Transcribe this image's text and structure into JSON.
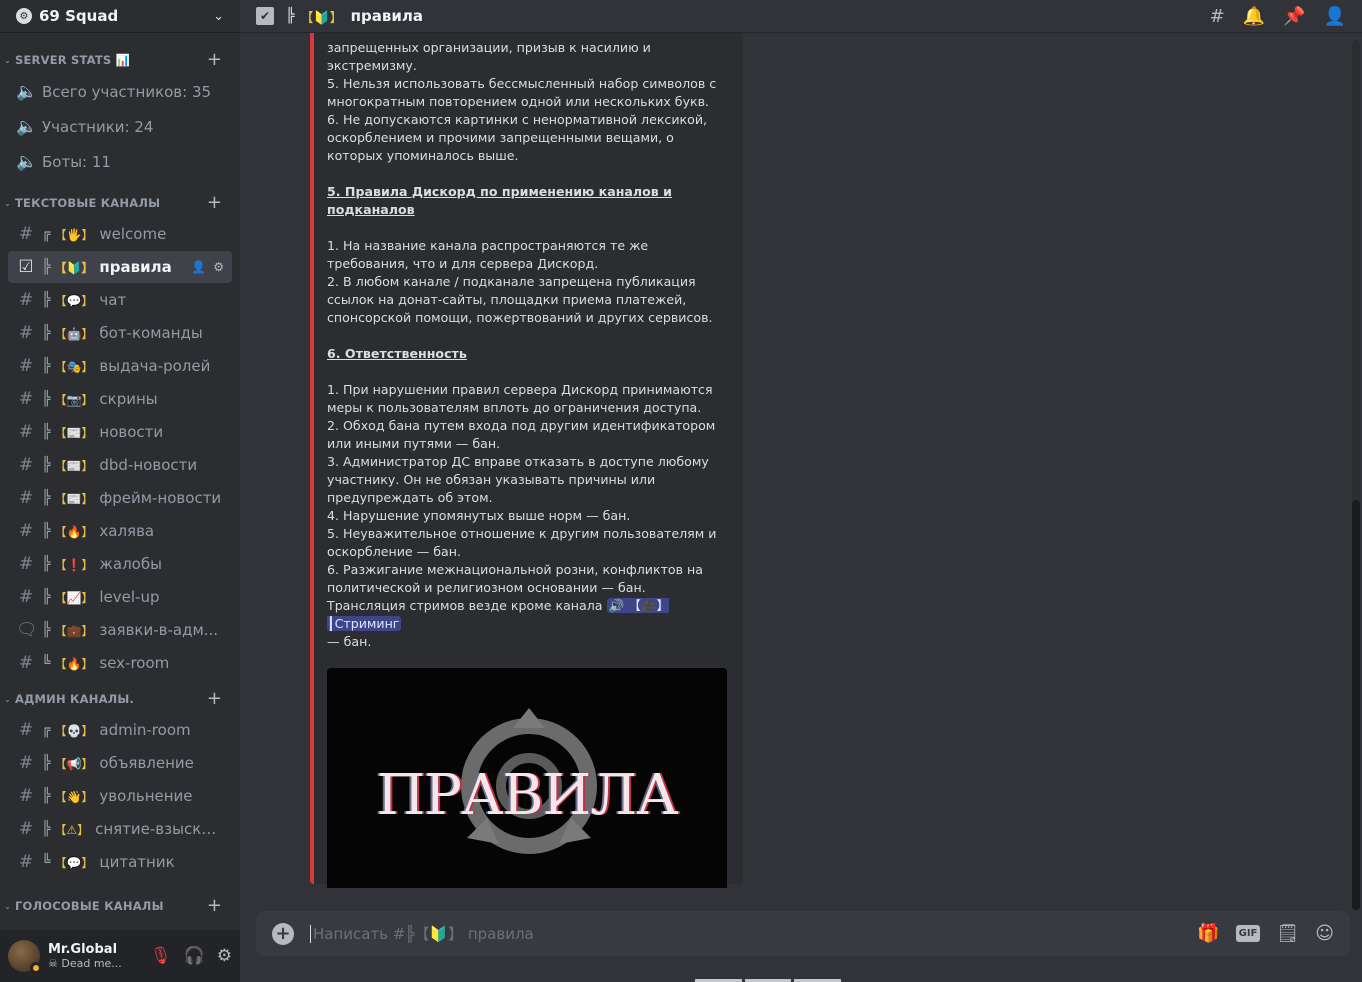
{
  "server": {
    "name": "69 Squad",
    "icon": "gear-icon"
  },
  "categories": {
    "stats": {
      "label": "SERVER STATS 📊",
      "items": [
        {
          "label": "Всего участников: 35"
        },
        {
          "label": "Участники: 24"
        },
        {
          "label": "Боты: 11"
        }
      ]
    },
    "text": {
      "label": "ТЕКСТОВЫЕ КАНАЛЫ",
      "items": [
        {
          "prefix": "╔",
          "emoji": "【🖐】",
          "label": "welcome"
        },
        {
          "prefix": "╠",
          "emoji": "【🔰】",
          "label": "правила"
        },
        {
          "prefix": "╠",
          "emoji": "【💬】",
          "label": "чат"
        },
        {
          "prefix": "╠",
          "emoji": "【🤖】",
          "label": "бот-команды"
        },
        {
          "prefix": "╠",
          "emoji": "【🎭】",
          "label": "выдача-ролей"
        },
        {
          "prefix": "╠",
          "emoji": "【📷】",
          "label": "скрины"
        },
        {
          "prefix": "╠",
          "emoji": "【📰】",
          "label": "новости"
        },
        {
          "prefix": "╠",
          "emoji": "【📰】",
          "label": "dbd-новости"
        },
        {
          "prefix": "╠",
          "emoji": "【📰】",
          "label": "фрейм-новости"
        },
        {
          "prefix": "╠",
          "emoji": "【🔥】",
          "label": "халява"
        },
        {
          "prefix": "╠",
          "emoji": "【❗】",
          "label": "жалобы"
        },
        {
          "prefix": "╠",
          "emoji": "【📈】",
          "label": "level-up"
        },
        {
          "prefix": "╠",
          "emoji": "【💼】",
          "label": "заявки-в-адм..."
        },
        {
          "prefix": "╚",
          "emoji": "【🔥】",
          "label": "sex-room"
        }
      ]
    },
    "admin": {
      "label": "АДМИН КАНАЛЫ.",
      "items": [
        {
          "prefix": "╔",
          "emoji": "【💀】",
          "label": "admin-room"
        },
        {
          "prefix": "╠",
          "emoji": "【📢】",
          "label": "объявление"
        },
        {
          "prefix": "╠",
          "emoji": "【👋】",
          "label": "увольнение"
        },
        {
          "prefix": "╠",
          "emoji": "【⚠】",
          "label": "снятие-взыска..."
        },
        {
          "prefix": "╚",
          "emoji": "【💬】",
          "label": "цитатник"
        }
      ]
    },
    "voice": {
      "label": "ГОЛОСОВЫЕ КАНАЛЫ"
    }
  },
  "topbar": {
    "prefix": "╠",
    "emoji": "【🔰】",
    "title": "правила"
  },
  "embed": {
    "lines_a": [
      "запрещенных организации, призыв к насилию и экстремизму.",
      "5. Нельзя использовать бессмысленный набор символов с многократным повторением одной или нескольких букв.",
      "6. Не допускаются картинки с ненормативной лексикой, оскорблением и прочими запрещенными вещами, о которых упоминалось выше."
    ],
    "heading_5": "5. Правила Дискорд по применению каналов и подканалов",
    "lines_b": [
      "1. На название канала распространяются те же требования, что и для сервера Дискорд.",
      "2. В любом канале / подканале запрещена публикация ссылок на донат-сайты, площадки приема платежей, спонсорской помощи, пожертвований и других сервисов."
    ],
    "heading_6": "6. Ответственность",
    "lines_c": [
      "1. При нарушении правил сервера Дискорд принимаются меры к пользователям вплоть до ограничения доступа.",
      "2. Обход бана путем входа под другим идентификатором или иными путями — бан.",
      "3. Администратор ДС вправе отказать в доступе любому участнику. Он не обязан указывать причины или предупреждать об этом.",
      "4. Нарушение упомянутых выше норм — бан.",
      "5. Неуважительное отношение к другим пользователям и оскорбление — бан.",
      "6. Разжигание межнациональной розни, конфликтов на политической и религиозном основании — бан."
    ],
    "stream_line": "Трансляция стримов везде кроме канала",
    "mention": "🔊 【🎥】 ┃Стриминг",
    "stream_tail": "— бан.",
    "image_text": "ПРАВИЛА"
  },
  "composer": {
    "placeholder": "Написать #╠【🔰】 правила"
  },
  "user": {
    "name": "Mr.Global",
    "status": "Dead me..."
  }
}
